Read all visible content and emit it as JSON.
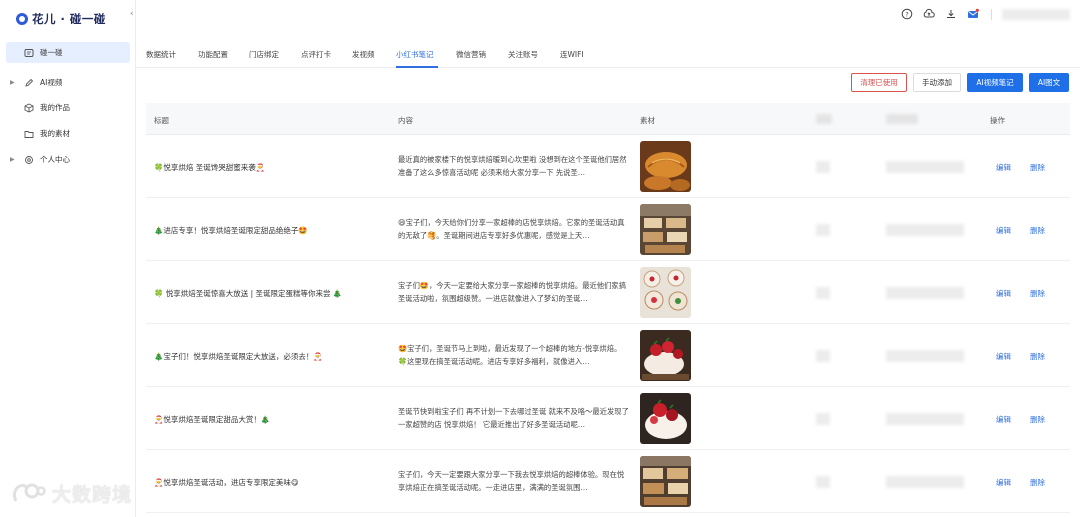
{
  "app": {
    "title": "花儿 · 碰一碰"
  },
  "sidebar": {
    "items": [
      {
        "label": "碰一碰",
        "icon": "tap-icon",
        "active": true
      },
      {
        "label": "AI视频",
        "icon": "edit-icon",
        "expandable": true
      },
      {
        "label": "我的作品",
        "icon": "cube-icon"
      },
      {
        "label": "我的素材",
        "icon": "folder-icon"
      },
      {
        "label": "个人中心",
        "icon": "gear-icon",
        "expandable": true
      }
    ]
  },
  "header": {
    "icons": [
      "help-icon",
      "cloud-upload-icon",
      "download-icon",
      "mail-icon"
    ],
    "notification_color": "#e23b3b"
  },
  "tabs": {
    "items": [
      "数据统计",
      "功能配置",
      "门店绑定",
      "点评打卡",
      "发视频",
      "小红书笔记",
      "微信营销",
      "关注账号",
      "连WIFI"
    ],
    "active": "小红书笔记"
  },
  "toolbar": {
    "clear_label": "清理已使用",
    "manual_label": "手动添加",
    "ai_video_label": "AI视频笔记",
    "ai_image_label": "AI图文"
  },
  "table": {
    "headers": {
      "title": "标题",
      "content": "内容",
      "material": "素材",
      "actions": "操作"
    },
    "edit_label": "编辑",
    "delete_label": "删除",
    "rows": [
      {
        "title": "🍀悦享烘焙 圣诞馋哭甜蜜来袭🎅",
        "content": "最近真的被家楼下的悦享烘焙暖到心坎里啦 没想到在这个圣诞他们居然准备了这么多惊喜活动呢 必须来给大家分享一下 先说圣…",
        "thumb": "croissant"
      },
      {
        "title": "🎄进店专享！悦享烘焙圣诞限定甜品绝绝子🤩",
        "content": "😄宝子们，今天给你们分享一家超棒的店悦享烘焙。它家的圣诞活动真的无敌了🥞。圣诞期间进店专享好多优惠呢，感觉是上天…",
        "thumb": "pastry-display"
      },
      {
        "title": "🍀 悦享烘焙圣诞惊喜大放送 | 圣诞限定蛋糕等你来尝 🎄",
        "content": "宝子们🤩，今天一定要给大家分享一家超棒的悦享烘焙。最近他们家搞圣诞活动啦，氛围超级赞。一进店就像进入了梦幻的圣诞…",
        "thumb": "cakes"
      },
      {
        "title": "🎄宝子们！悦享烘焙圣诞限定大放送，必须去！🎅",
        "content": "🤩宝子们，圣诞节马上到啦，最近发现了一个超棒的地方-悦享烘焙。🍀这里现在搞圣诞活动呢。进店专享好多福利，就像进入…",
        "thumb": "strawberry"
      },
      {
        "title": "🎅悦享烘焙圣诞限定甜品大赏！🎄",
        "content": "圣诞节快到啦宝子们 再不计划一下去哪过圣诞 就来不及咯～最近发现了一家超赞的店 悦享烘焙！ 它最近推出了好多圣诞活动呢…",
        "thumb": "strawberry2"
      },
      {
        "title": "🎅悦享烘焙圣诞活动，进店专享限定美味😋",
        "content": "宝子们，今天一定要跟大家分享一下我去悦享烘焙的超棒体验。现在悦享烘焙正在搞圣诞活动呢。一走进店里，满满的圣诞氛围…",
        "thumb": "pastry-display2"
      }
    ]
  },
  "watermark": {
    "text": "大数跨境"
  }
}
